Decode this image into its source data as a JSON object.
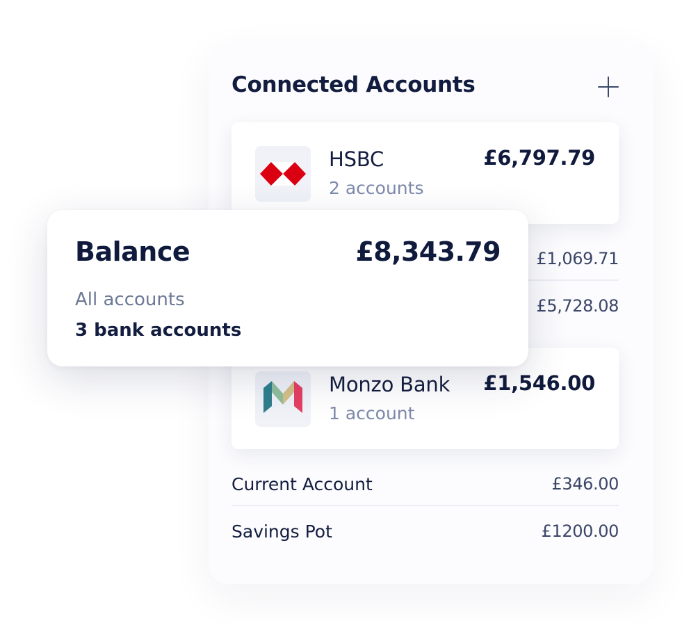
{
  "header": {
    "title": "Connected Accounts",
    "add_icon": "plus-icon"
  },
  "banks": [
    {
      "name": "HSBC",
      "accounts_label": "2 accounts",
      "total": "£6,797.79",
      "logo": "hsbc-logo",
      "colors": {
        "primary": "#db0011"
      },
      "sub_accounts": [
        {
          "name": "",
          "amount": "£1,069.71"
        },
        {
          "name": "",
          "amount": "£5,728.08"
        }
      ]
    },
    {
      "name": "Monzo Bank",
      "accounts_label": "1 account",
      "total": "£1,546.00",
      "logo": "monzo-logo",
      "colors": {
        "teal": "#2f7f8c",
        "green": "#8fbf9d",
        "gold": "#d5c089",
        "pink": "#e53f63"
      },
      "sub_accounts": [
        {
          "name": "Current Account",
          "amount": "£346.00"
        },
        {
          "name": "Savings Pot",
          "amount": "£1200.00"
        }
      ]
    }
  ],
  "balance_card": {
    "title": "Balance",
    "amount": "£8,343.79",
    "scope": "All accounts",
    "count_label": "3 bank accounts"
  },
  "colors": {
    "text_dark": "#0f1a3c",
    "text_muted": "#7e8aab",
    "card_bg": "#ffffff"
  }
}
